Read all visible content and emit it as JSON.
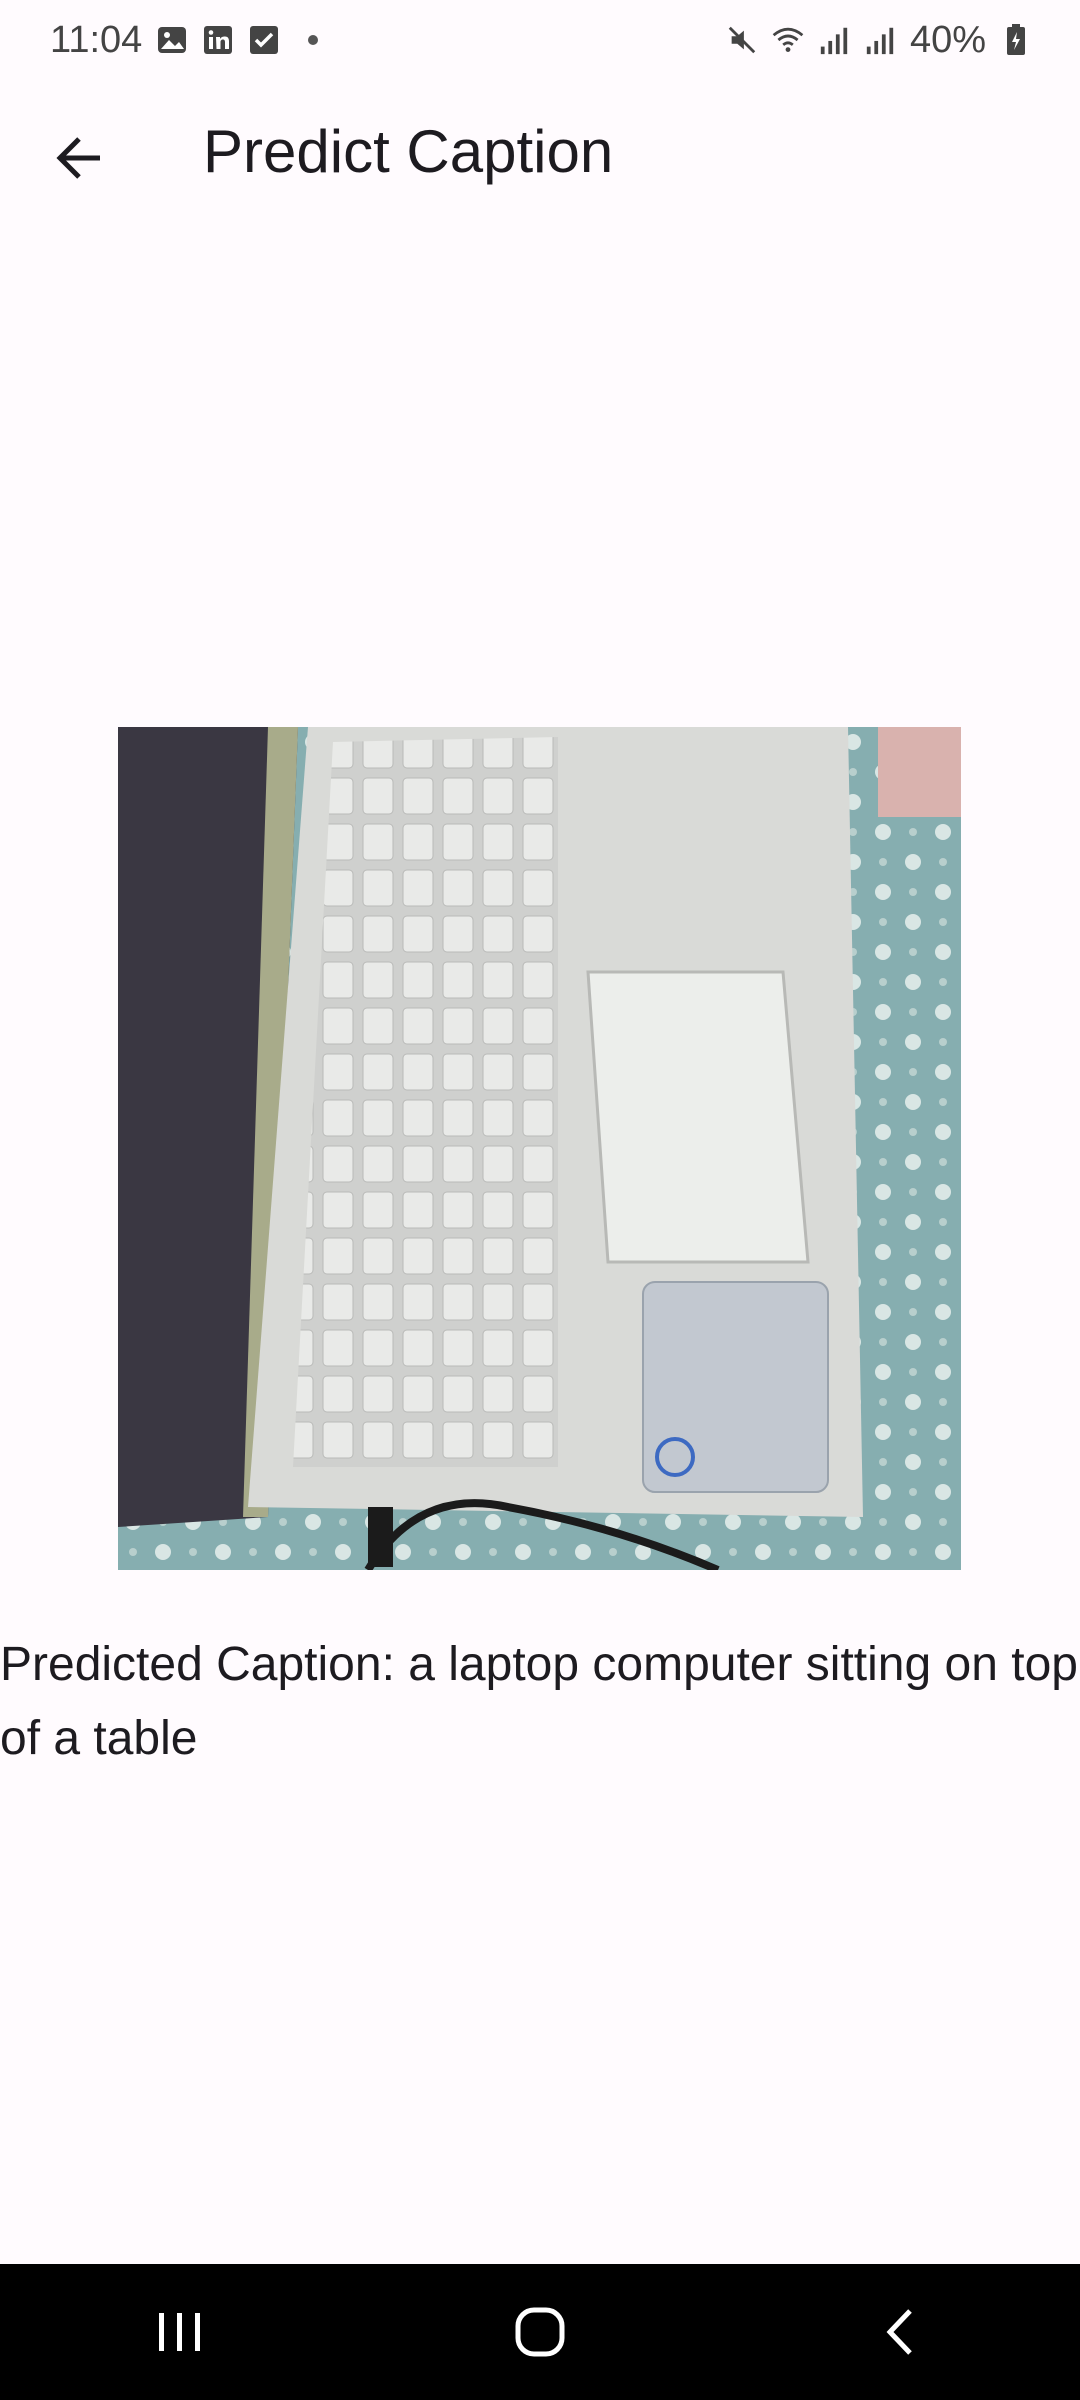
{
  "status_bar": {
    "time": "11:04",
    "battery": "40%",
    "notification_icons": [
      "gallery-icon",
      "linkedin-icon",
      "checkbox-icon"
    ],
    "system_icons": [
      "mute-icon",
      "wifi-icon",
      "signal-icon",
      "signal-icon",
      "battery-icon"
    ]
  },
  "app_bar": {
    "title": "Predict Caption"
  },
  "image": {
    "subject": "laptop computer on table"
  },
  "caption": {
    "text": "Predicted Caption: a laptop computer sitting on top of a table"
  },
  "nav_bar": {
    "buttons": [
      "recents-icon",
      "home-icon",
      "back-icon"
    ]
  }
}
